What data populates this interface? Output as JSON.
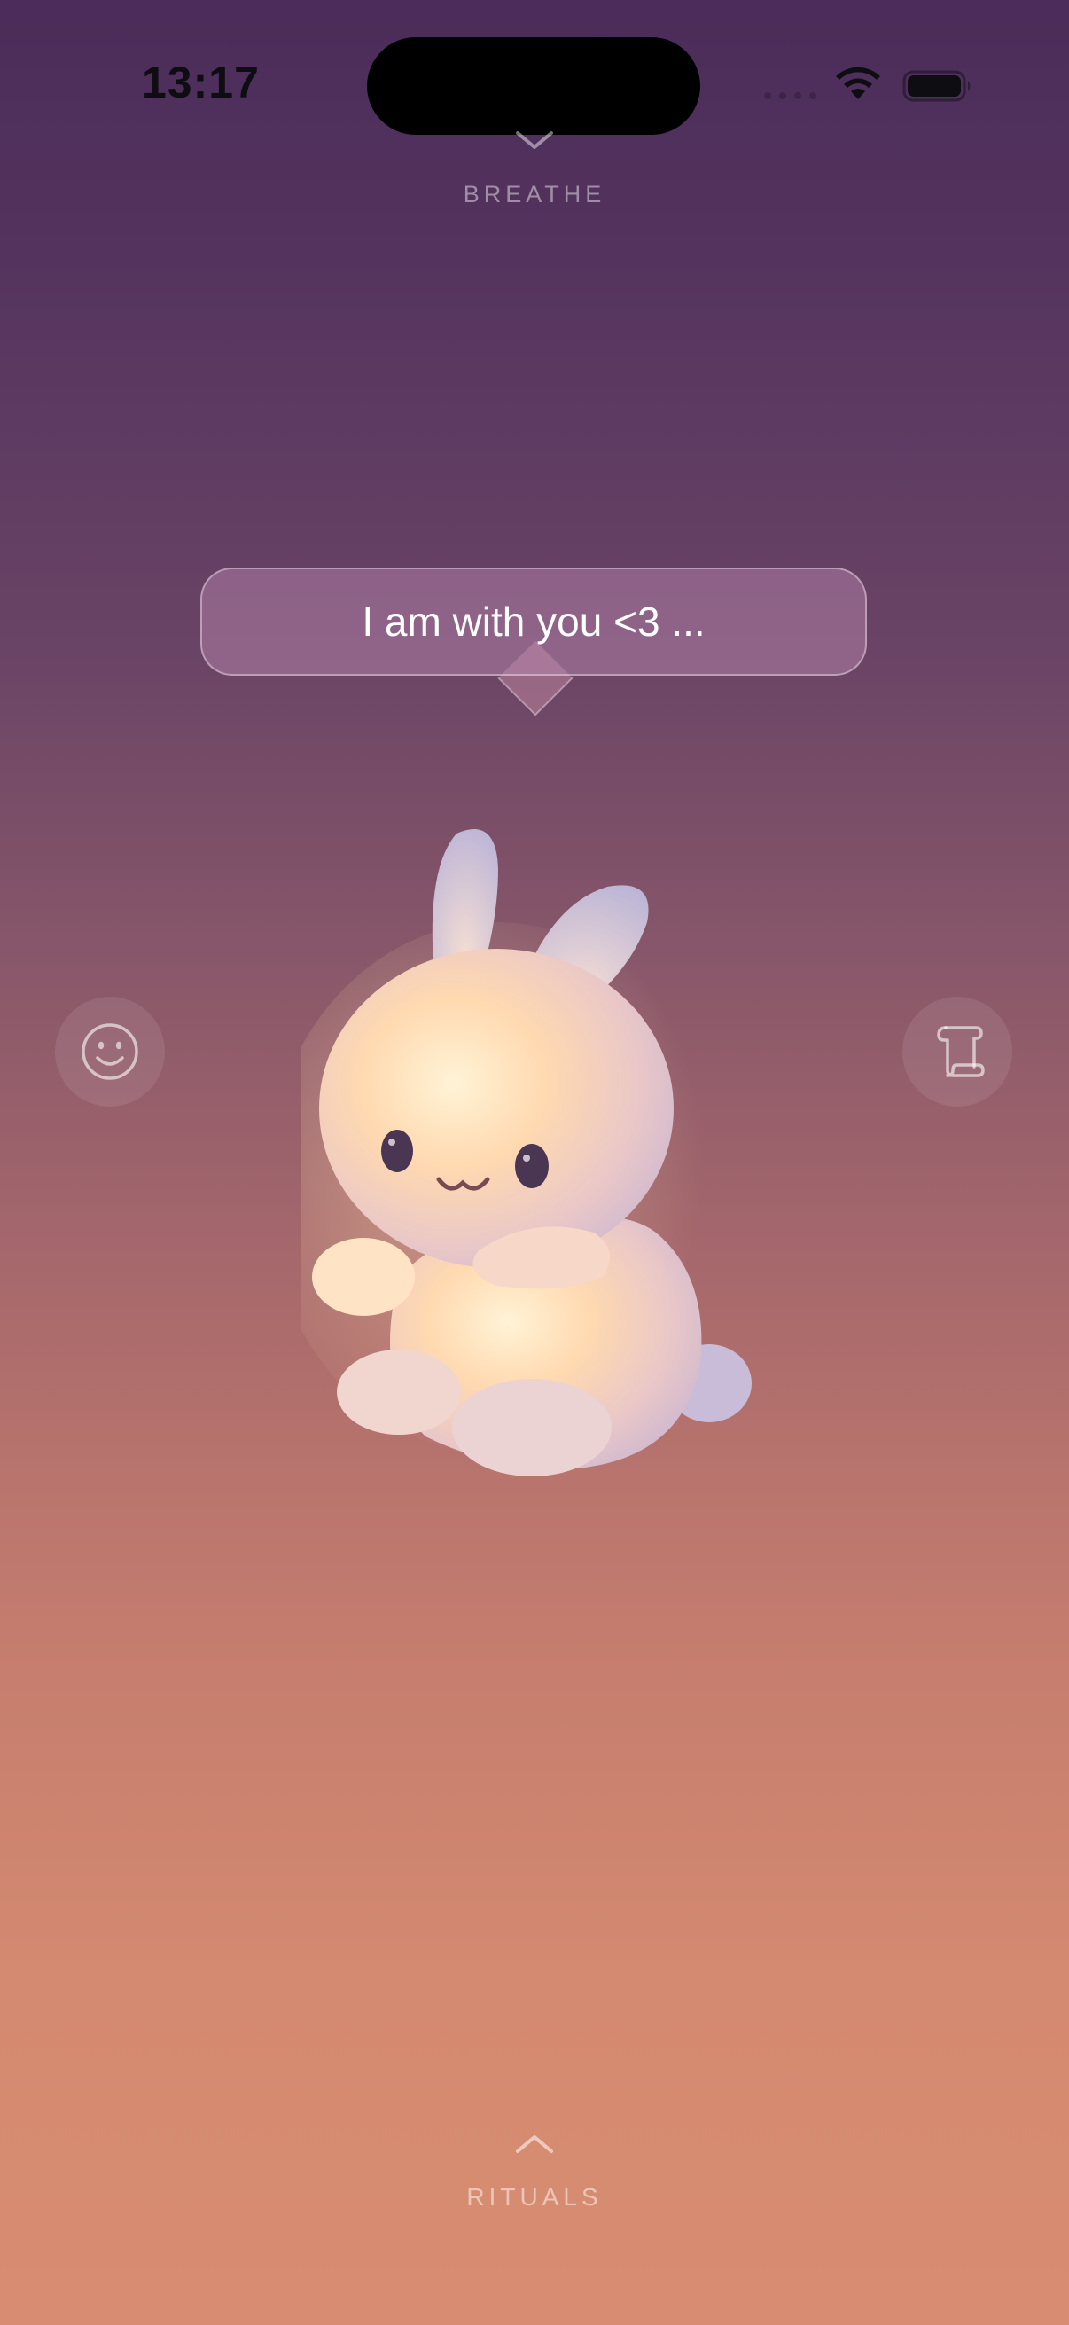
{
  "status_bar": {
    "time": "13:17"
  },
  "top_nav": {
    "label": "BREATHE",
    "icon": "chevron-down-icon"
  },
  "speech_bubble": {
    "text": "I am with you <3 ..."
  },
  "side_buttons": {
    "left_icon": "smiley-face-icon",
    "right_icon": "scroll-icon"
  },
  "character": {
    "name": "bunny"
  },
  "bottom_nav": {
    "label": "RITUALS",
    "icon": "chevron-up-icon"
  },
  "colors": {
    "bg_top": "#4b2c5a",
    "bg_bottom": "#d88d72",
    "status_text": "#0d0d12",
    "bubble_bg": "#b48cb4"
  }
}
